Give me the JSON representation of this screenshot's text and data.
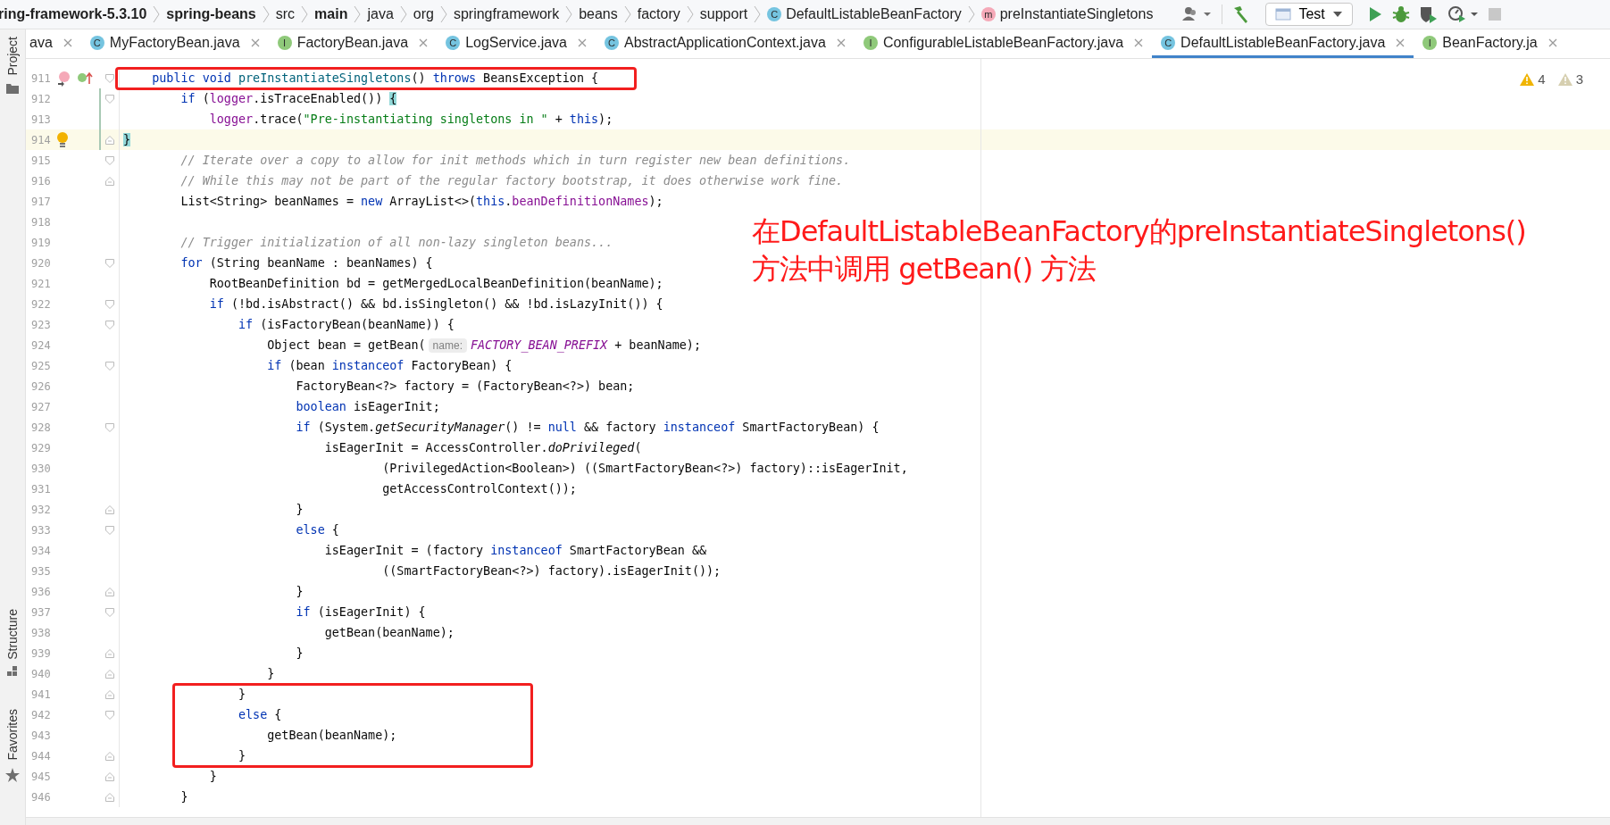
{
  "breadcrumbs": [
    {
      "label": "ring-framework-5.3.10",
      "bold": true
    },
    {
      "label": "spring-beans",
      "bold": true
    },
    {
      "label": "src",
      "bold": false
    },
    {
      "label": "main",
      "bold": true
    },
    {
      "label": "java",
      "bold": false
    },
    {
      "label": "org",
      "bold": false
    },
    {
      "label": "springframework",
      "bold": false
    },
    {
      "label": "beans",
      "bold": false
    },
    {
      "label": "factory",
      "bold": false
    },
    {
      "label": "support",
      "bold": false
    },
    {
      "label": "DefaultListableBeanFactory",
      "bold": false,
      "badge": "C",
      "kind": "class"
    },
    {
      "label": "preInstantiateSingletons",
      "bold": false,
      "badge": "m",
      "kind": "method"
    }
  ],
  "run_config": {
    "label": "Test"
  },
  "tabs": [
    {
      "label": "ava",
      "selected": false
    },
    {
      "label": "MyFactoryBean.java",
      "badge": "C",
      "kind": "class",
      "selected": false
    },
    {
      "label": "FactoryBean.java",
      "badge": "I",
      "kind": "interface",
      "selected": false
    },
    {
      "label": "LogService.java",
      "badge": "C",
      "kind": "class",
      "selected": false
    },
    {
      "label": "AbstractApplicationContext.java",
      "badge": "C",
      "kind": "class",
      "selected": false
    },
    {
      "label": "ConfigurableListableBeanFactory.java",
      "badge": "I",
      "kind": "interface",
      "selected": false
    },
    {
      "label": "DefaultListableBeanFactory.java",
      "badge": "C",
      "kind": "class",
      "selected": true
    },
    {
      "label": "BeanFactory.ja",
      "badge": "I",
      "kind": "interface",
      "selected": false
    }
  ],
  "tool_windows": [
    {
      "label": "Project",
      "kind": "folder"
    },
    {
      "label": "Structure",
      "kind": "structure"
    },
    {
      "label": "Favorites",
      "kind": "star"
    }
  ],
  "inspections": [
    {
      "kind": "warning",
      "count": "4"
    },
    {
      "kind": "weak_warning",
      "count": "3"
    }
  ],
  "lines": [
    {
      "number": "911",
      "current": false,
      "changed": false,
      "outlined": true,
      "fold": {
        "kind": "start"
      },
      "gutter_icon": {
        "kind": "override"
      },
      "tokens": [
        {
          "kind": "kw",
          "text": "    public void "
        },
        {
          "kind": "decl",
          "text": "preInstantiateSingletons"
        },
        {
          "kind": "plain",
          "text": "() "
        },
        {
          "kind": "kw",
          "text": "throws"
        },
        {
          "kind": "plain",
          "text": " BeansException {"
        }
      ]
    },
    {
      "number": "912",
      "current": false,
      "changed": true,
      "outlined": false,
      "fold": {
        "kind": "start"
      },
      "tokens": [
        {
          "kind": "kw",
          "text": "        if"
        },
        {
          "kind": "plain",
          "text": " ("
        },
        {
          "kind": "field",
          "text": "logger"
        },
        {
          "kind": "plain",
          "text": ".isTraceEnabled()) "
        },
        {
          "kind": "match",
          "text": "{"
        }
      ]
    },
    {
      "number": "913",
      "current": false,
      "changed": true,
      "outlined": false,
      "tokens": [
        {
          "kind": "field",
          "text": "            logger"
        },
        {
          "kind": "plain",
          "text": ".trace("
        },
        {
          "kind": "str",
          "text": "\"Pre-instantiating singletons in \""
        },
        {
          "kind": "plain",
          "text": " + "
        },
        {
          "kind": "kw",
          "text": "this"
        },
        {
          "kind": "plain",
          "text": ");"
        }
      ]
    },
    {
      "number": "914",
      "current": true,
      "changed": true,
      "outlined": false,
      "fold": {
        "kind": "end"
      },
      "gutter_icon": {
        "kind": "bulb"
      },
      "tokens": [
        {
          "kind": "match",
          "text": "}"
        }
      ]
    },
    {
      "number": "915",
      "current": false,
      "changed": false,
      "outlined": false,
      "fold": {
        "kind": "start"
      },
      "tokens": [
        {
          "kind": "cmt",
          "text": "        // Iterate over a copy to allow for init methods which in turn register new bean definitions."
        }
      ]
    },
    {
      "number": "916",
      "current": false,
      "changed": false,
      "outlined": false,
      "fold": {
        "kind": "end"
      },
      "tokens": [
        {
          "kind": "cmt",
          "text": "        // While this may not be part of the regular factory bootstrap, it does otherwise work fine."
        }
      ]
    },
    {
      "number": "917",
      "current": false,
      "changed": false,
      "outlined": false,
      "tokens": [
        {
          "kind": "plain",
          "text": "        List<String> beanNames = "
        },
        {
          "kind": "kw",
          "text": "new"
        },
        {
          "kind": "plain",
          "text": " ArrayList<>("
        },
        {
          "kind": "kw",
          "text": "this"
        },
        {
          "kind": "plain",
          "text": "."
        },
        {
          "kind": "field",
          "text": "beanDefinitionNames"
        },
        {
          "kind": "plain",
          "text": ");"
        }
      ]
    },
    {
      "number": "918",
      "current": false,
      "changed": false,
      "outlined": false
    },
    {
      "number": "919",
      "current": false,
      "changed": false,
      "outlined": false,
      "tokens": [
        {
          "kind": "cmt",
          "text": "        // Trigger initialization of all non-lazy singleton beans..."
        }
      ]
    },
    {
      "number": "920",
      "current": false,
      "changed": false,
      "outlined": false,
      "fold": {
        "kind": "start"
      },
      "tokens": [
        {
          "kind": "kw",
          "text": "        for"
        },
        {
          "kind": "plain",
          "text": " (String beanName : beanNames) {"
        }
      ]
    },
    {
      "number": "921",
      "current": false,
      "changed": false,
      "outlined": false,
      "tokens": [
        {
          "kind": "plain",
          "text": "            RootBeanDefinition bd = getMergedLocalBeanDefinition(beanName);"
        }
      ]
    },
    {
      "number": "922",
      "current": false,
      "changed": false,
      "outlined": false,
      "fold": {
        "kind": "start"
      },
      "tokens": [
        {
          "kind": "kw",
          "text": "            if"
        },
        {
          "kind": "plain",
          "text": " (!bd.isAbstract() && bd.isSingleton() && !bd.isLazyInit()) {"
        }
      ]
    },
    {
      "number": "923",
      "current": false,
      "changed": false,
      "outlined": false,
      "fold": {
        "kind": "start"
      },
      "tokens": [
        {
          "kind": "kw",
          "text": "                if"
        },
        {
          "kind": "plain",
          "text": " (isFactoryBean(beanName)) {"
        }
      ]
    },
    {
      "number": "924",
      "current": false,
      "changed": false,
      "outlined": false,
      "tokens": [
        {
          "kind": "plain",
          "text": "                    Object bean = getBean("
        },
        {
          "kind": "hint",
          "text": "name:"
        },
        {
          "kind": "const",
          "text": "FACTORY_BEAN_PREFIX"
        },
        {
          "kind": "plain",
          "text": " + beanName);"
        }
      ]
    },
    {
      "number": "925",
      "current": false,
      "changed": false,
      "outlined": false,
      "fold": {
        "kind": "start"
      },
      "tokens": [
        {
          "kind": "kw",
          "text": "                    if"
        },
        {
          "kind": "plain",
          "text": " (bean "
        },
        {
          "kind": "kw",
          "text": "instanceof"
        },
        {
          "kind": "plain",
          "text": " FactoryBean) {"
        }
      ]
    },
    {
      "number": "926",
      "current": false,
      "changed": false,
      "outlined": false,
      "tokens": [
        {
          "kind": "plain",
          "text": "                        FactoryBean<?> factory = (FactoryBean<?>) bean;"
        }
      ]
    },
    {
      "number": "927",
      "current": false,
      "changed": false,
      "outlined": false,
      "tokens": [
        {
          "kind": "kw",
          "text": "                        boolean"
        },
        {
          "kind": "plain",
          "text": " isEagerInit;"
        }
      ]
    },
    {
      "number": "928",
      "current": false,
      "changed": false,
      "outlined": false,
      "fold": {
        "kind": "start"
      },
      "tokens": [
        {
          "kind": "kw",
          "text": "                        if"
        },
        {
          "kind": "plain",
          "text": " (System."
        },
        {
          "kind": "it",
          "text": "getSecurityManager"
        },
        {
          "kind": "plain",
          "text": "() != "
        },
        {
          "kind": "kw",
          "text": "null"
        },
        {
          "kind": "plain",
          "text": " && factory "
        },
        {
          "kind": "kw",
          "text": "instanceof"
        },
        {
          "kind": "plain",
          "text": " SmartFactoryBean) {"
        }
      ]
    },
    {
      "number": "929",
      "current": false,
      "changed": false,
      "outlined": false,
      "tokens": [
        {
          "kind": "plain",
          "text": "                            isEagerInit = AccessController."
        },
        {
          "kind": "it",
          "text": "doPrivileged"
        },
        {
          "kind": "plain",
          "text": "("
        }
      ]
    },
    {
      "number": "930",
      "current": false,
      "changed": false,
      "outlined": false,
      "tokens": [
        {
          "kind": "plain",
          "text": "                                    (PrivilegedAction<Boolean>) ((SmartFactoryBean<?>) factory)::isEagerInit,"
        }
      ]
    },
    {
      "number": "931",
      "current": false,
      "changed": false,
      "outlined": false,
      "tokens": [
        {
          "kind": "plain",
          "text": "                                    getAccessControlContext());"
        }
      ]
    },
    {
      "number": "932",
      "current": false,
      "changed": false,
      "outlined": false,
      "fold": {
        "kind": "end"
      },
      "tokens": [
        {
          "kind": "plain",
          "text": "                        }"
        }
      ]
    },
    {
      "number": "933",
      "current": false,
      "changed": false,
      "outlined": false,
      "fold": {
        "kind": "start"
      },
      "tokens": [
        {
          "kind": "kw",
          "text": "                        else"
        },
        {
          "kind": "plain",
          "text": " {"
        }
      ]
    },
    {
      "number": "934",
      "current": false,
      "changed": false,
      "outlined": false,
      "tokens": [
        {
          "kind": "plain",
          "text": "                            isEagerInit = (factory "
        },
        {
          "kind": "kw",
          "text": "instanceof"
        },
        {
          "kind": "plain",
          "text": " SmartFactoryBean &&"
        }
      ]
    },
    {
      "number": "935",
      "current": false,
      "changed": false,
      "outlined": false,
      "tokens": [
        {
          "kind": "plain",
          "text": "                                    ((SmartFactoryBean<?>) factory).isEagerInit());"
        }
      ]
    },
    {
      "number": "936",
      "current": false,
      "changed": false,
      "outlined": false,
      "fold": {
        "kind": "end"
      },
      "tokens": [
        {
          "kind": "plain",
          "text": "                        }"
        }
      ]
    },
    {
      "number": "937",
      "current": false,
      "changed": false,
      "outlined": false,
      "fold": {
        "kind": "start"
      },
      "tokens": [
        {
          "kind": "kw",
          "text": "                        if"
        },
        {
          "kind": "plain",
          "text": " (isEagerInit) {"
        }
      ]
    },
    {
      "number": "938",
      "current": false,
      "changed": false,
      "outlined": false,
      "tokens": [
        {
          "kind": "plain",
          "text": "                            getBean(beanName);"
        }
      ]
    },
    {
      "number": "939",
      "current": false,
      "changed": false,
      "outlined": false,
      "fold": {
        "kind": "end"
      },
      "tokens": [
        {
          "kind": "plain",
          "text": "                        }"
        }
      ]
    },
    {
      "number": "940",
      "current": false,
      "changed": false,
      "outlined": false,
      "fold": {
        "kind": "end"
      },
      "tokens": [
        {
          "kind": "plain",
          "text": "                    }"
        }
      ]
    },
    {
      "number": "941",
      "current": false,
      "changed": false,
      "outlined": true,
      "fold": {
        "kind": "end"
      },
      "tokens": [
        {
          "kind": "plain",
          "text": "                }"
        }
      ]
    },
    {
      "number": "942",
      "current": false,
      "changed": false,
      "outlined": true,
      "fold": {
        "kind": "start"
      },
      "tokens": [
        {
          "kind": "kw",
          "text": "                else"
        },
        {
          "kind": "plain",
          "text": " {"
        }
      ]
    },
    {
      "number": "943",
      "current": false,
      "changed": false,
      "outlined": true,
      "tokens": [
        {
          "kind": "plain",
          "text": "                    getBean(beanName);"
        }
      ]
    },
    {
      "number": "944",
      "current": false,
      "changed": false,
      "outlined": true,
      "fold": {
        "kind": "end"
      },
      "tokens": [
        {
          "kind": "plain",
          "text": "                }"
        }
      ]
    },
    {
      "number": "945",
      "current": false,
      "changed": false,
      "outlined": false,
      "fold": {
        "kind": "end"
      },
      "tokens": [
        {
          "kind": "plain",
          "text": "            }"
        }
      ]
    },
    {
      "number": "946",
      "current": false,
      "changed": false,
      "outlined": false,
      "fold": {
        "kind": "end"
      },
      "tokens": [
        {
          "kind": "plain",
          "text": "        }"
        }
      ]
    }
  ],
  "annotation": {
    "lines": [
      "在DefaultListableBeanFactory的preInstantiateSingletons()",
      "方法中调用 getBean() 方法"
    ]
  }
}
